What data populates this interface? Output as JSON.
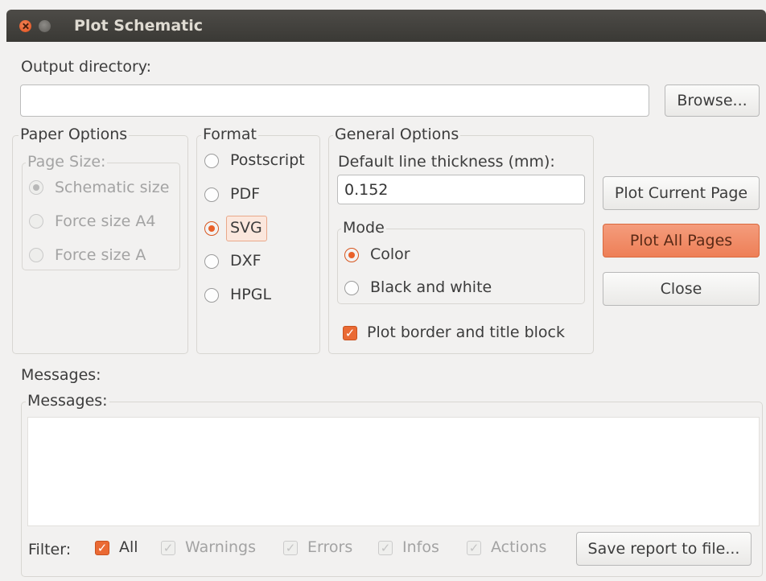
{
  "window": {
    "title": "Plot Schematic"
  },
  "output": {
    "label": "Output directory:",
    "value": "",
    "browse_label": "Browse..."
  },
  "paper_options": {
    "legend": "Paper Options",
    "page_size_legend": "Page Size:",
    "options": [
      {
        "label": "Schematic size",
        "selected": true
      },
      {
        "label": "Force size A4",
        "selected": false
      },
      {
        "label": "Force size A",
        "selected": false
      }
    ]
  },
  "format": {
    "legend": "Format",
    "options": [
      {
        "label": "Postscript",
        "selected": false
      },
      {
        "label": "PDF",
        "selected": false
      },
      {
        "label": "SVG",
        "selected": true
      },
      {
        "label": "DXF",
        "selected": false
      },
      {
        "label": "HPGL",
        "selected": false
      }
    ]
  },
  "general_options": {
    "legend": "General Options",
    "line_thickness_label": "Default line thickness (mm):",
    "line_thickness_value": "0.152",
    "mode_legend": "Mode",
    "mode_options": [
      {
        "label": "Color",
        "selected": true
      },
      {
        "label": "Black and white",
        "selected": false
      }
    ],
    "plot_border_label": "Plot border and title block",
    "plot_border_checked": true
  },
  "actions": {
    "plot_current_label": "Plot Current Page",
    "plot_all_label": "Plot All Pages",
    "close_label": "Close"
  },
  "messages": {
    "label": "Messages:",
    "legend": "Messages:",
    "content": ""
  },
  "filter": {
    "label": "Filter:",
    "items": [
      {
        "label": "All",
        "checked": true,
        "enabled": true
      },
      {
        "label": "Warnings",
        "checked": true,
        "enabled": false
      },
      {
        "label": "Errors",
        "checked": true,
        "enabled": false
      },
      {
        "label": "Infos",
        "checked": true,
        "enabled": false
      },
      {
        "label": "Actions",
        "checked": true,
        "enabled": false
      }
    ],
    "save_label": "Save report to file..."
  },
  "colors": {
    "accent": "#ee7f57",
    "titlebar": "#3c3b37"
  }
}
